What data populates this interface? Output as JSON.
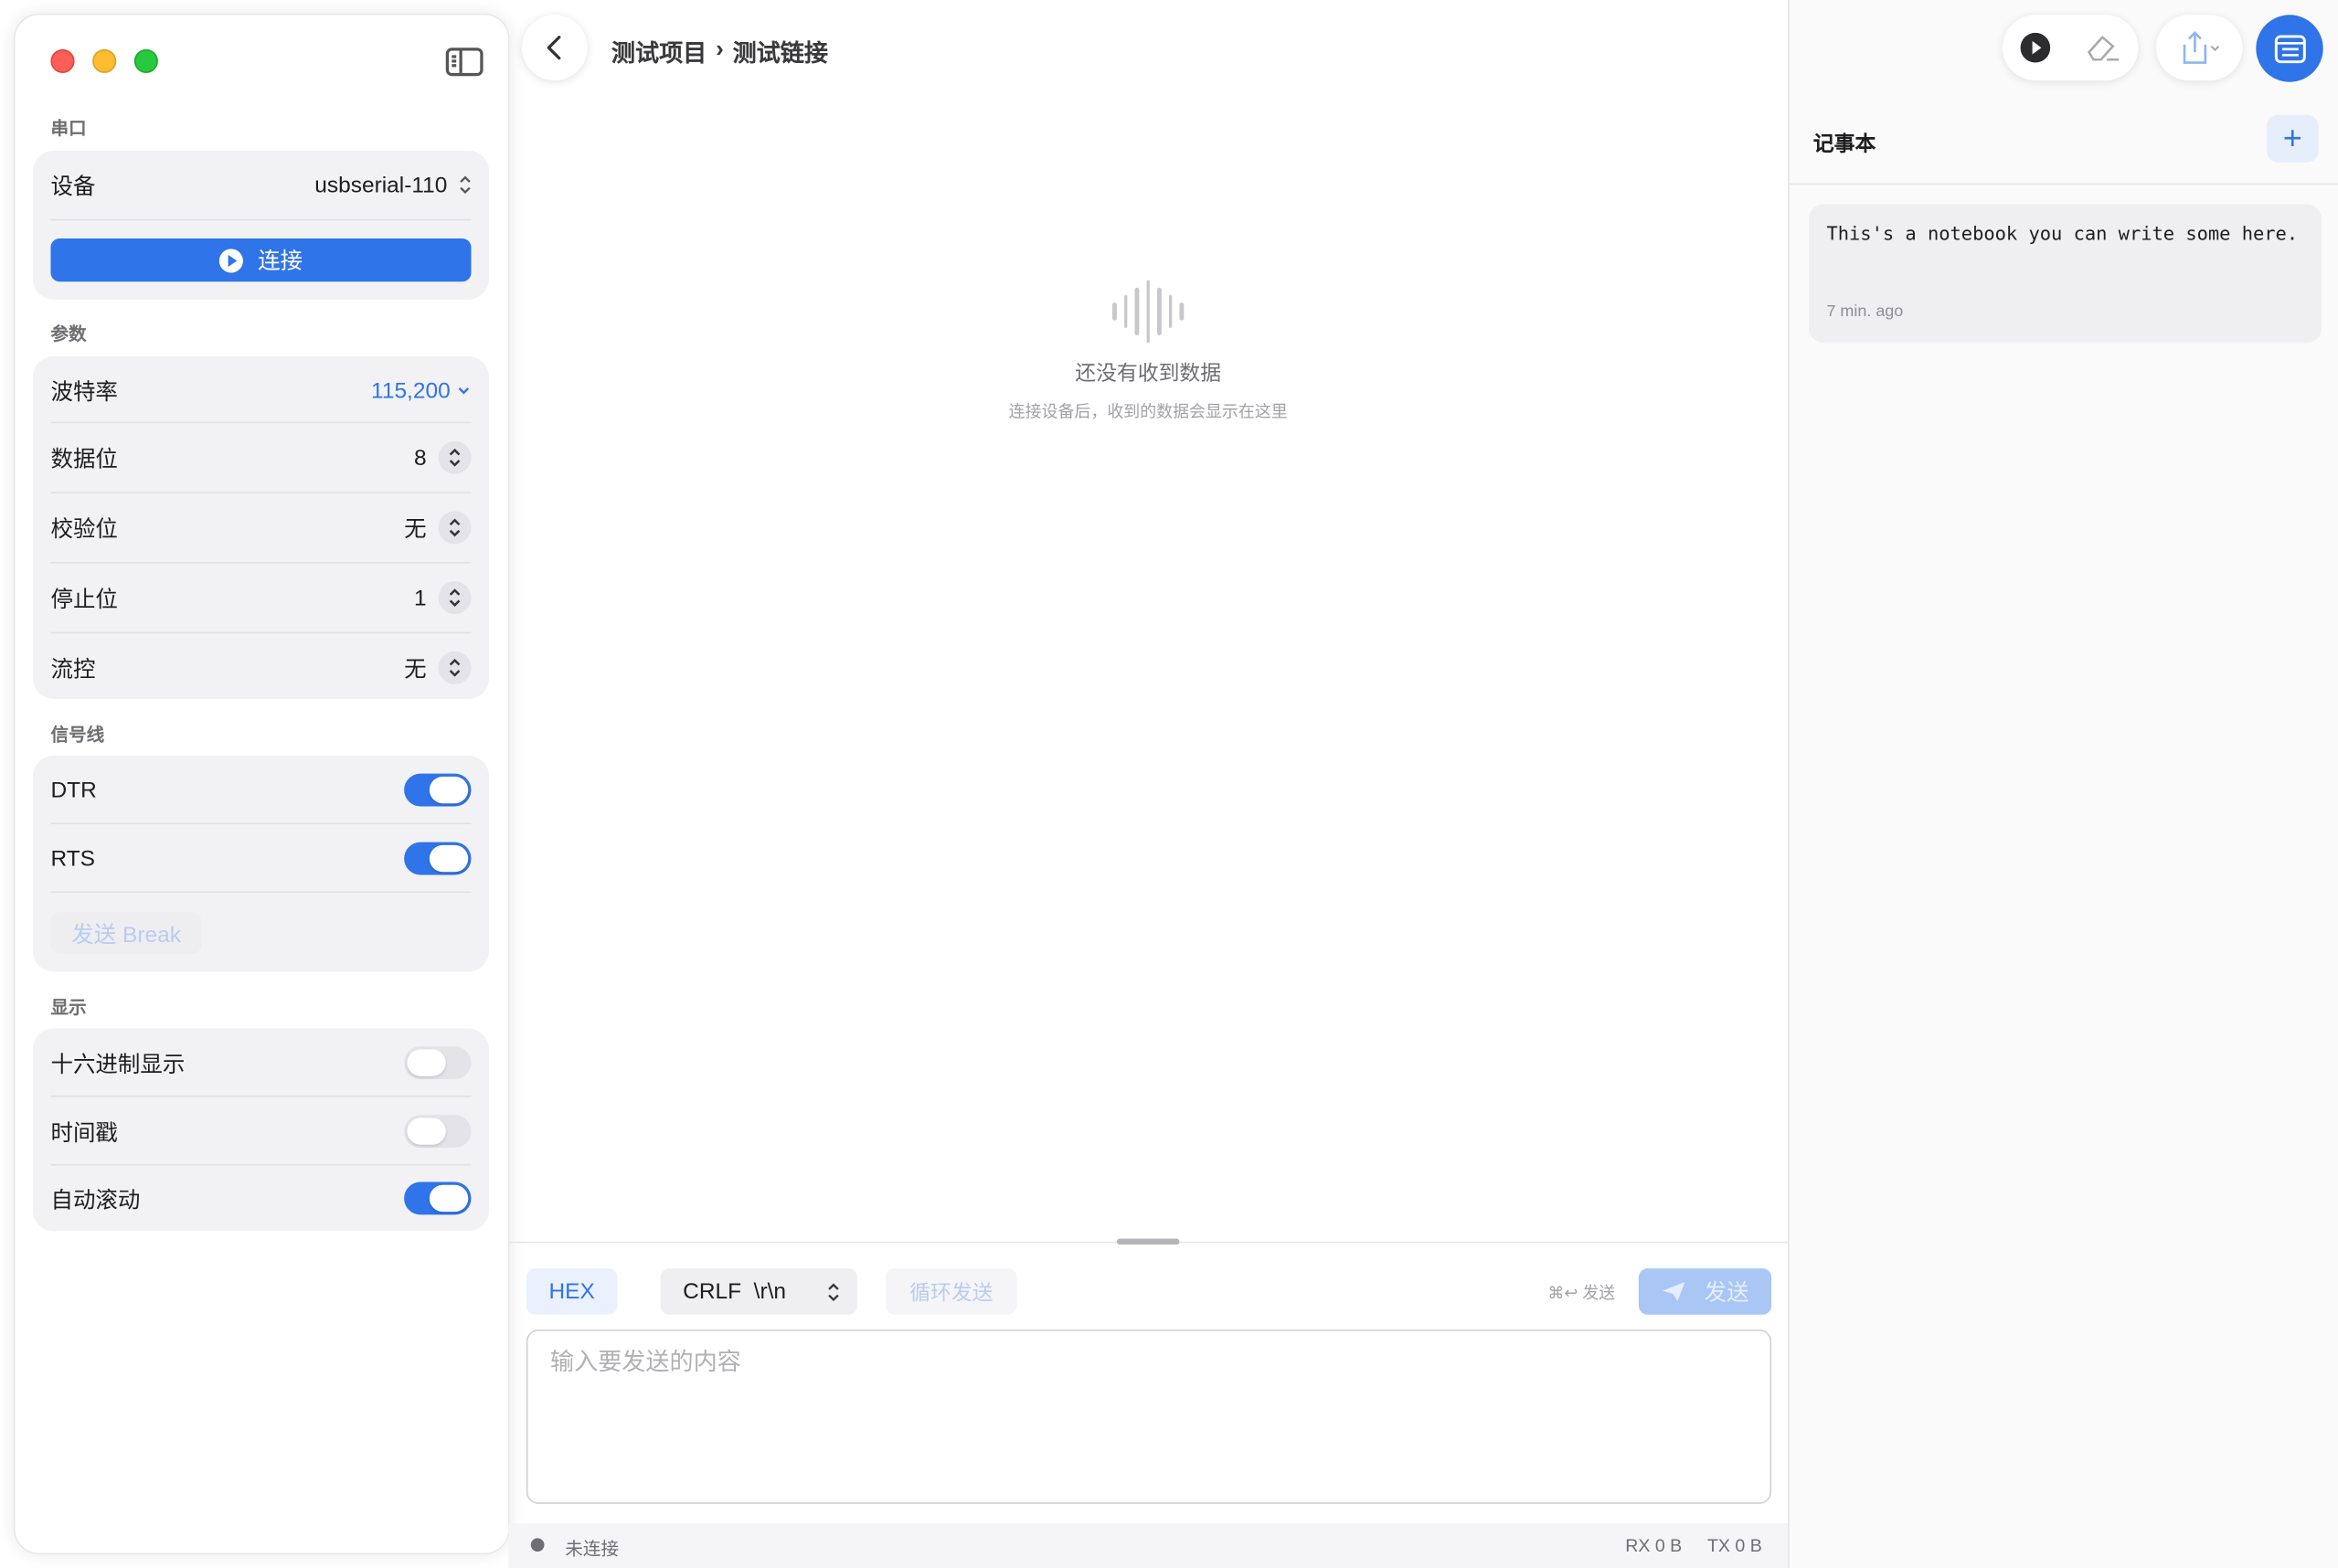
{
  "sidebar": {
    "serial_section": "串口",
    "device_label": "设备",
    "device_value": "usbserial-110",
    "connect_label": "连接",
    "params_section": "参数",
    "params": [
      {
        "label": "波特率",
        "value": "115,200"
      },
      {
        "label": "数据位",
        "value": "8"
      },
      {
        "label": "校验位",
        "value": "无"
      },
      {
        "label": "停止位",
        "value": "1"
      },
      {
        "label": "流控",
        "value": "无"
      }
    ],
    "signal_section": "信号线",
    "signals": [
      {
        "label": "DTR",
        "on": true
      },
      {
        "label": "RTS",
        "on": true
      }
    ],
    "break_label": "发送 Break",
    "display_section": "显示",
    "display": [
      {
        "label": "十六进制显示",
        "on": false
      },
      {
        "label": "时间戳",
        "on": false
      },
      {
        "label": "自动滚动",
        "on": true
      }
    ]
  },
  "header": {
    "project": "测试项目",
    "separator": "›",
    "link": "测试链接"
  },
  "empty": {
    "title": "还没有收到数据",
    "subtitle": "连接设备后，收到的数据会显示在这里"
  },
  "send": {
    "hex_label": "HEX",
    "line_ending": "CRLF  \\r\\n",
    "loop_label": "循环发送",
    "shortcut": "⌘↩ 发送",
    "send_label": "发送",
    "placeholder": "输入要发送的内容"
  },
  "status": {
    "state": "未连接",
    "rx": "RX 0 B",
    "tx": "TX 0 B"
  },
  "notes": {
    "title": "记事本",
    "add": "+",
    "items": [
      {
        "text": "This's a notebook you can write some here.",
        "time": "7 min. ago"
      }
    ]
  },
  "colors": {
    "accent": "#2f74e8",
    "close": "#ff5f57",
    "minimize": "#febc2e",
    "zoom": "#28c840"
  },
  "icons": [
    "sidebar-toggle-icon",
    "play-icon",
    "back-chevron-icon",
    "waveform-icon",
    "eraser-icon",
    "share-icon",
    "notebook-icon",
    "paper-plane-icon",
    "up-down-chevron-icon"
  ]
}
